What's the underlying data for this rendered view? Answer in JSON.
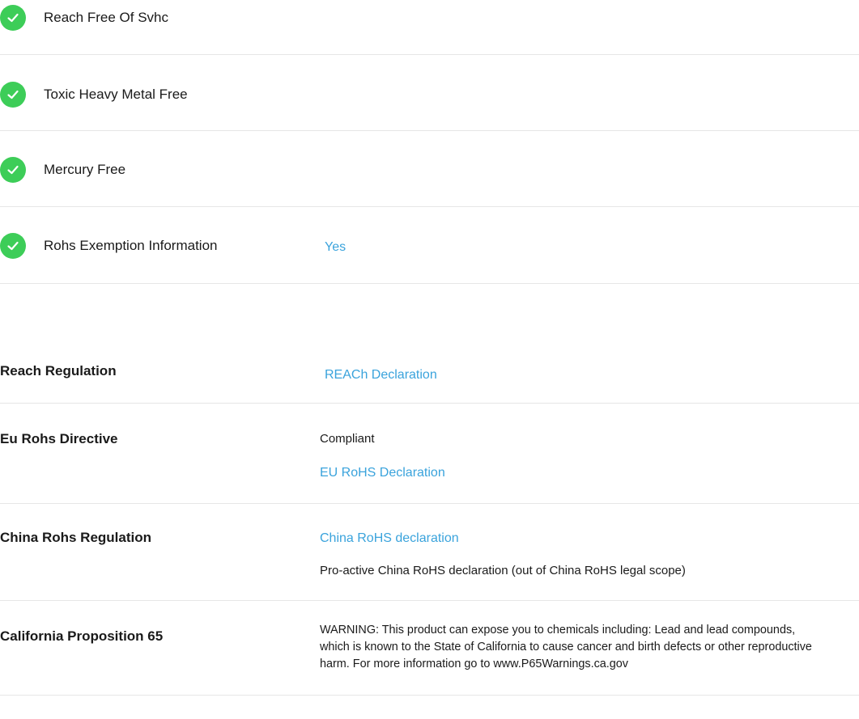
{
  "checks": [
    {
      "label": "Reach Free Of Svhc",
      "icon": "checkmark-icon"
    },
    {
      "label": "Toxic Heavy Metal Free",
      "icon": "checkmark-icon"
    },
    {
      "label": "Mercury Free",
      "icon": "checkmark-icon"
    },
    {
      "label": "Rohs Exemption Information",
      "value": "Yes",
      "icon": "checkmark-icon"
    }
  ],
  "regulations": {
    "reach": {
      "title": "Reach Regulation",
      "link": "REACh Declaration"
    },
    "eu_rohs": {
      "title": "Eu Rohs Directive",
      "status": "Compliant",
      "link": "EU RoHS Declaration"
    },
    "china_rohs": {
      "title": "China Rohs Regulation",
      "link": "China RoHS declaration",
      "note": "Pro-active China RoHS declaration (out of China RoHS legal scope)"
    },
    "prop65": {
      "title": "California Proposition 65",
      "warning": "WARNING: This product can expose you to chemicals including: Lead and lead compounds, which is known to the State of California to cause cancer and birth defects or other reproductive harm. For more information go to www.P65Warnings.ca.gov"
    }
  },
  "colors": {
    "check_green": "#3dcd58",
    "link_blue": "#3aa3dc",
    "divider": "#e6e6e6"
  }
}
